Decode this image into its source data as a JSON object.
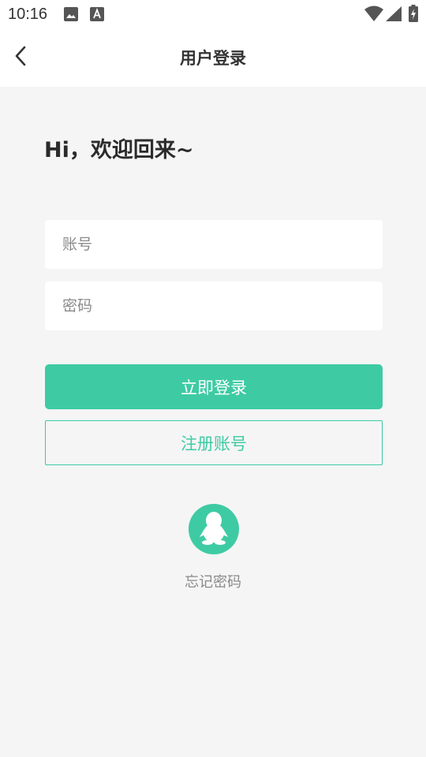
{
  "status_bar": {
    "time": "10:16",
    "icons": [
      "image-icon",
      "text-a-icon",
      "wifi-icon",
      "signal-icon",
      "battery-charging-icon"
    ]
  },
  "header": {
    "title": "用户登录",
    "back_icon": "chevron-left-icon"
  },
  "greeting": "Hi，欢迎回来~",
  "form": {
    "account_placeholder": "账号",
    "password_placeholder": "密码",
    "account_value": "",
    "password_value": ""
  },
  "buttons": {
    "login_label": "立即登录",
    "register_label": "注册账号"
  },
  "social": {
    "qq_icon": "qq-penguin-icon"
  },
  "forgot_password_label": "忘记密码",
  "colors": {
    "accent": "#3ecba3",
    "background": "#f5f5f5",
    "surface": "#ffffff",
    "text_primary": "#333333",
    "text_secondary": "#8a8a8a"
  }
}
